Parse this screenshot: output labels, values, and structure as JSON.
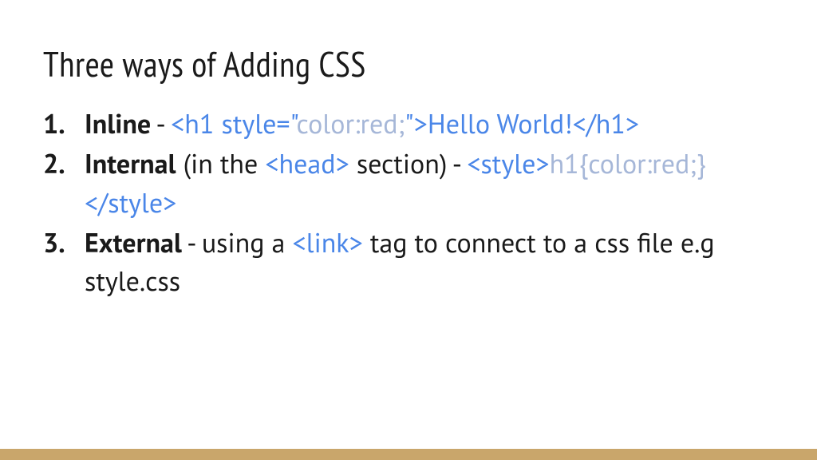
{
  "title": "Three ways of Adding CSS",
  "items": [
    {
      "label": "Inline",
      "dash1": " - ",
      "code1_tag_open": "<h1 style=\"",
      "code1_attr": "color:red;",
      "code1_tag_mid": "\">Hello World!</h1>"
    },
    {
      "label": "Internal",
      "plain1": " (in the ",
      "head_tag": "<head>",
      "plain2": " section) - ",
      "style_open": "<style>",
      "style_body": "h1{color:red;}",
      "style_close": "</style>"
    },
    {
      "label": "External",
      "plain1": " - using a ",
      "link_tag": "<link>",
      "plain2": " tag to connect to a css file e.g style.css"
    }
  ]
}
